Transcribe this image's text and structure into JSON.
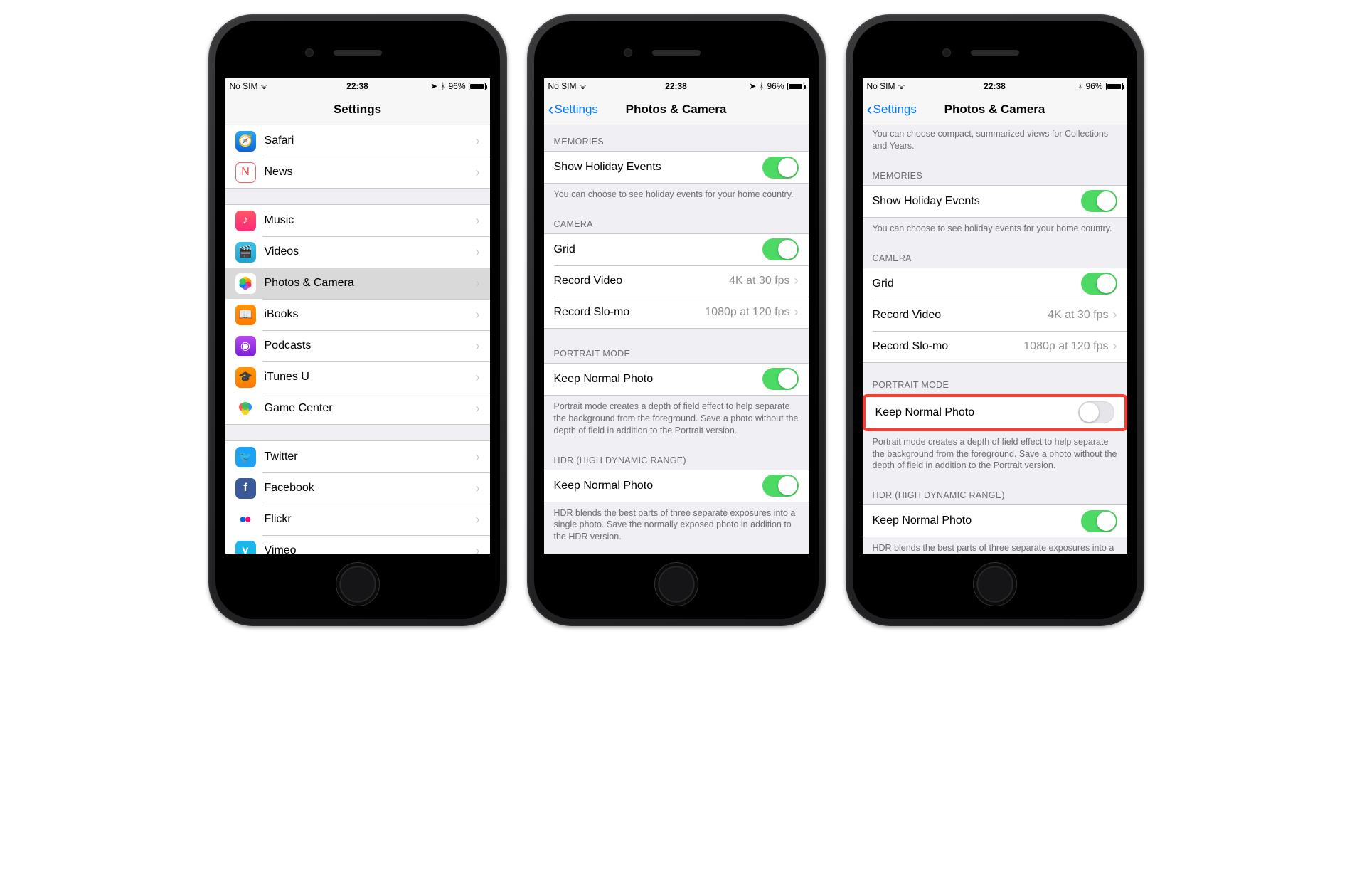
{
  "status": {
    "carrier": "No SIM",
    "time": "22:38",
    "battery": "96%"
  },
  "screen1": {
    "title": "Settings",
    "group1": [
      {
        "label": "Safari"
      },
      {
        "label": "News"
      }
    ],
    "group2": [
      {
        "label": "Music"
      },
      {
        "label": "Videos"
      },
      {
        "label": "Photos & Camera",
        "selected": true
      },
      {
        "label": "iBooks"
      },
      {
        "label": "Podcasts"
      },
      {
        "label": "iTunes U"
      },
      {
        "label": "Game Center"
      }
    ],
    "group3": [
      {
        "label": "Twitter"
      },
      {
        "label": "Facebook"
      },
      {
        "label": "Flickr"
      },
      {
        "label": "Vimeo"
      }
    ]
  },
  "screen2": {
    "back": "Settings",
    "title": "Photos & Camera",
    "memories_header": "MEMORIES",
    "show_holiday": "Show Holiday Events",
    "holiday_footer": "You can choose to see holiday events for your home country.",
    "camera_header": "CAMERA",
    "grid": "Grid",
    "record_video": "Record Video",
    "record_video_val": "4K at 30 fps",
    "record_slomo": "Record Slo-mo",
    "record_slomo_val": "1080p at 120 fps",
    "portrait_header": "PORTRAIT MODE",
    "keep_normal": "Keep Normal Photo",
    "portrait_footer": "Portrait mode creates a depth of field effect to help separate the background from the foreground. Save a photo without the depth of field in addition to the Portrait version.",
    "hdr_header": "HDR (HIGH DYNAMIC RANGE)",
    "hdr_keep": "Keep Normal Photo",
    "hdr_footer": "HDR blends the best parts of three separate exposures into a single photo. Save the normally exposed photo in addition to the HDR version."
  },
  "screen3": {
    "back": "Settings",
    "title": "Photos & Camera",
    "top_footer": "You can choose compact, summarized views for Collections and Years.",
    "memories_header": "MEMORIES",
    "show_holiday": "Show Holiday Events",
    "holiday_footer": "You can choose to see holiday events for your home country.",
    "camera_header": "CAMERA",
    "grid": "Grid",
    "record_video": "Record Video",
    "record_video_val": "4K at 30 fps",
    "record_slomo": "Record Slo-mo",
    "record_slomo_val": "1080p at 120 fps",
    "portrait_header": "PORTRAIT MODE",
    "keep_normal": "Keep Normal Photo",
    "portrait_footer": "Portrait mode creates a depth of field effect to help separate the background from the foreground. Save a photo without the depth of field in addition to the Portrait version.",
    "hdr_header": "HDR (HIGH DYNAMIC RANGE)",
    "hdr_keep": "Keep Normal Photo",
    "hdr_footer": "HDR blends the best parts of three separate exposures into a single photo. Save the normally exposed photo in addition to the HDR version."
  }
}
